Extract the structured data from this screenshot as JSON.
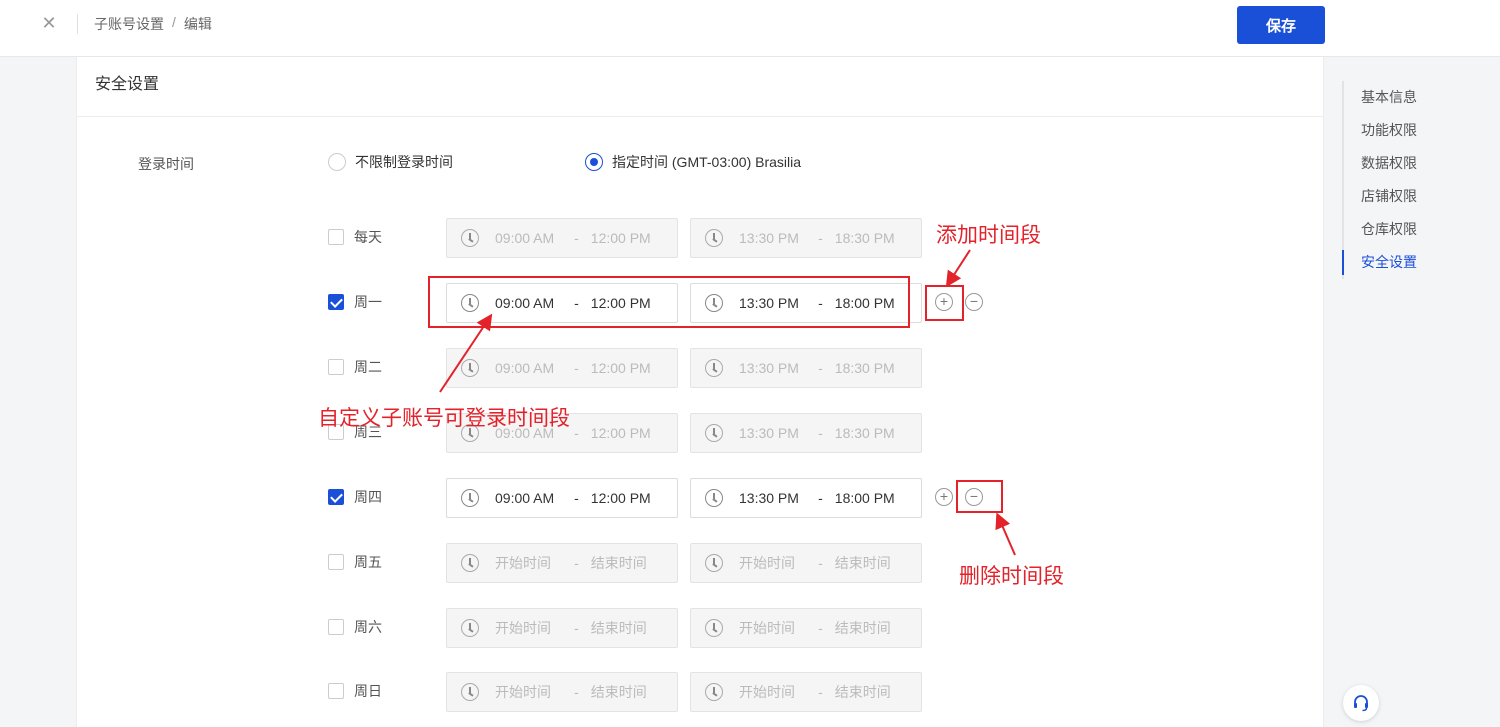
{
  "header": {
    "close_icon": "close-icon",
    "breadcrumb": [
      "子账号设置",
      "编辑"
    ],
    "separator": "/",
    "save_label": "保存"
  },
  "section": {
    "title": "安全设置"
  },
  "side_nav": {
    "items": [
      "基本信息",
      "功能权限",
      "数据权限",
      "店铺权限",
      "仓库权限",
      "安全设置"
    ],
    "active": "安全设置"
  },
  "login_time": {
    "label": "登录时间",
    "option_unlimited": "不限制登录时间",
    "option_specified": "指定时间 (GMT-03:00) Brasilia",
    "selected": "指定时间 (GMT-03:00) Brasilia"
  },
  "days": [
    {
      "label": "每天",
      "checked": false,
      "slot1": {
        "start": "09:00 AM",
        "end": "12:00 PM"
      },
      "slot2": {
        "start": "13:30 PM",
        "end": "18:30 PM"
      }
    },
    {
      "label": "周一",
      "checked": true,
      "slot1": {
        "start": "09:00 AM",
        "end": "12:00 PM"
      },
      "slot2": {
        "start": "13:30 PM",
        "end": "18:00 PM"
      }
    },
    {
      "label": "周二",
      "checked": false,
      "slot1": {
        "start": "09:00 AM",
        "end": "12:00 PM"
      },
      "slot2": {
        "start": "13:30 PM",
        "end": "18:30 PM"
      }
    },
    {
      "label": "周三",
      "checked": false,
      "slot1": {
        "start": "09:00 AM",
        "end": "12:00 PM"
      },
      "slot2": {
        "start": "13:30 PM",
        "end": "18:30 PM"
      }
    },
    {
      "label": "周四",
      "checked": true,
      "slot1": {
        "start": "09:00 AM",
        "end": "12:00 PM"
      },
      "slot2": {
        "start": "13:30 PM",
        "end": "18:00 PM"
      }
    },
    {
      "label": "周五",
      "checked": false,
      "slot1": {
        "start": "开始时间",
        "end": "结束时间"
      },
      "slot2": {
        "start": "开始时间",
        "end": "结束时间"
      }
    },
    {
      "label": "周六",
      "checked": false,
      "slot1": {
        "start": "开始时间",
        "end": "结束时间"
      },
      "slot2": {
        "start": "开始时间",
        "end": "结束时间"
      }
    },
    {
      "label": "周日",
      "checked": false,
      "slot1": {
        "start": "开始时间",
        "end": "结束时间"
      },
      "slot2": {
        "start": "开始时间",
        "end": "结束时间"
      }
    }
  ],
  "time_separator": "-",
  "annotations": {
    "add_period": "添加时间段",
    "custom_period": "自定义子账号可登录时间段",
    "delete_period": "删除时间段"
  },
  "colors": {
    "primary": "#1a4fd8",
    "annotation": "#e3222a"
  },
  "icons": {
    "clock": "clock-icon",
    "add": "plus-circle-icon",
    "remove": "minus-circle-icon",
    "support": "headset-icon"
  }
}
